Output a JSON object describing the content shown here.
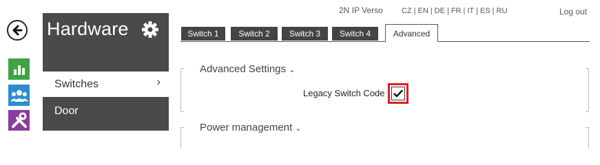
{
  "header": {
    "device_name": "2N IP Verso",
    "languages": [
      "CZ",
      "EN",
      "DE",
      "FR",
      "IT",
      "ES",
      "RU"
    ],
    "logout_label": "Log out"
  },
  "sidebar": {
    "title": "Hardware",
    "items": [
      {
        "label": "Switches",
        "active": true
      },
      {
        "label": "Door",
        "active": false
      }
    ],
    "rail_icons": [
      "status-icon",
      "users-icon",
      "services-icon"
    ],
    "colors": {
      "status": "#3ea346",
      "users": "#2a8dd1",
      "services": "#8b3c9a",
      "panel": "#4a4a4a"
    }
  },
  "tabs": [
    {
      "label": "Switch 1",
      "active": false
    },
    {
      "label": "Switch 2",
      "active": false
    },
    {
      "label": "Switch 3",
      "active": false
    },
    {
      "label": "Switch 4",
      "active": false
    },
    {
      "label": "Advanced",
      "active": true
    }
  ],
  "sections": {
    "advanced": {
      "title": "Advanced Settings",
      "legacy_switch_code": {
        "label": "Legacy Switch Code",
        "checked": true
      }
    },
    "power": {
      "title": "Power management"
    }
  },
  "highlight_color": "#e01b24"
}
